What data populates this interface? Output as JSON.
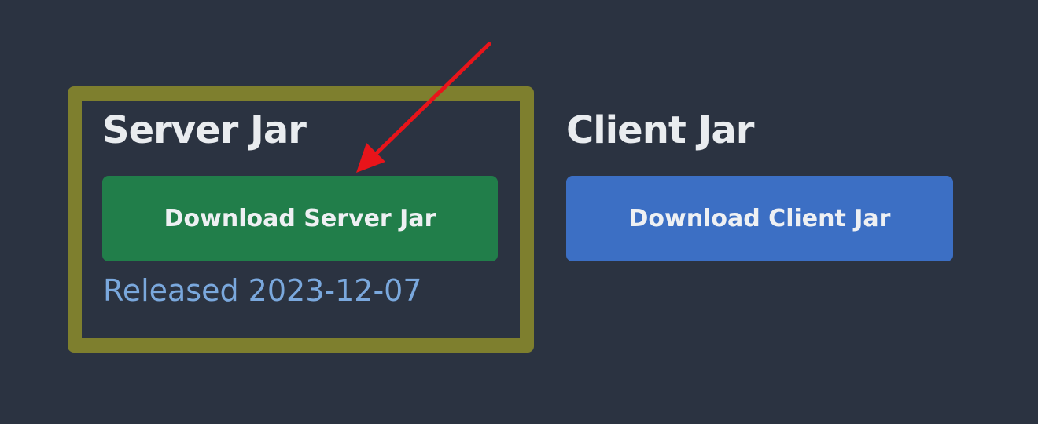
{
  "server": {
    "heading": "Server Jar",
    "button_label": "Download Server Jar",
    "release_text": "Released 2023-12-07",
    "button_color": "#217e4a"
  },
  "client": {
    "heading": "Client Jar",
    "button_label": "Download Client Jar",
    "button_color": "#3c6fc4"
  },
  "annotations": {
    "highlight_color": "#7e7f2e",
    "arrow_color": "#e8141a"
  },
  "colors": {
    "background": "#2b3341",
    "heading_text": "#e9ecef",
    "release_text": "#7aa8dd"
  }
}
